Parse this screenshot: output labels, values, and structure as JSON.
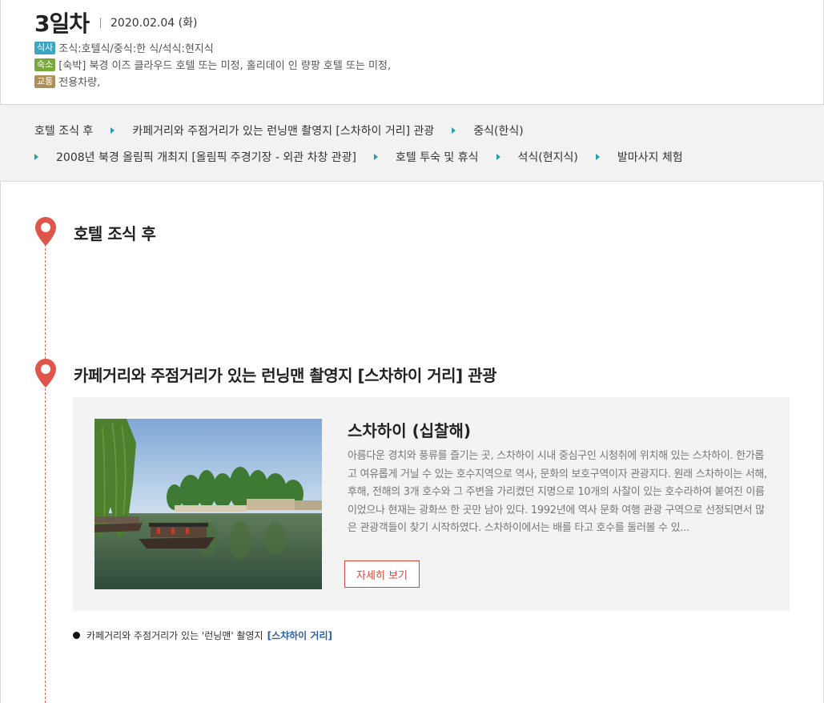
{
  "day": {
    "title": "3일차",
    "date": "2020.02.04 (화)"
  },
  "info": {
    "meal": {
      "tag": "식사",
      "text": "조식:호텔식/중식:한 식/석식:현지식"
    },
    "hotel": {
      "tag": "숙소",
      "text": "[숙박] 북경 이즈 클라우드 호텔 또는 미정, 홀리데이 인 량팡 호텔 또는 미정,"
    },
    "transport": {
      "tag": "교통",
      "text": "전용차량,"
    }
  },
  "schedule": [
    "호텔 조식 후",
    "카페거리와 주점거리가 있는 런닝맨 촬영지 [스차하이 거리] 관광",
    "중식(한식)",
    "2008년 북경 올림픽 개최지 [올림픽 주경기장 - 외관 차창 관광]",
    "호텔 투숙 및 휴식",
    "석식(현지식)",
    "발마사지 체험"
  ],
  "stops": {
    "stop1": {
      "title": "호텔 조식 후"
    },
    "stop2": {
      "title": "카페거리와 주점거리가 있는 런닝맨 촬영지 [스차하이 거리] 관광"
    }
  },
  "card": {
    "name": "스차하이 (십찰해)",
    "description": "아름다운 경치와 풍류를 즐기는 곳, 스차하이 시내 중심구인 시청취에 위치해 있는 스차하이. 한가롭고 여유롭게 거닐 수 있는 호수지역으로 역사, 문화의 보호구역이자 관광지다. 원래 스차하이는 서해, 후해, 전해의 3개 호수와 그 주변을 가리켰던 지명으로 10개의 사찰이 있는 호수라하여 붙여진 이름이었으나 현재는 광화쓰 한 곳만 남아 있다. 1992년에 역사 문화 여행 관광 구역으로 선정되면서 많은 관광객들이 찾기 시작하였다. 스차하이에서는 배를 타고 호수를 둘러볼 수 있...",
    "button_label": "자세히 보기"
  },
  "note": {
    "text": "카페거리와 주점거리가 있는 '런닝맨' 촬영지",
    "link": "[스챠하이 거리]"
  },
  "colors": {
    "accent_blue": "#2e9bb5",
    "pin_red": "#e0544a",
    "button_red": "#d64a3b",
    "link_blue": "#2f5fa8"
  }
}
